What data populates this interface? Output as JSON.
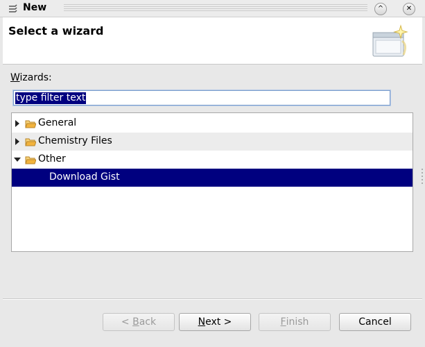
{
  "window": {
    "title": "New"
  },
  "header": {
    "title": "Select a wizard"
  },
  "wizards": {
    "label_first": "W",
    "label_rest": "izards:",
    "filter_value": "type filter text"
  },
  "tree": {
    "items": [
      {
        "label": "General",
        "expanded": false
      },
      {
        "label": "Chemistry Files",
        "expanded": false
      },
      {
        "label": "Other",
        "expanded": true
      },
      {
        "label": "Download Gist",
        "selected": true
      }
    ]
  },
  "buttons": {
    "back": {
      "prefix": "< ",
      "mnemonic": "B",
      "rest": "ack",
      "enabled": false
    },
    "next": {
      "mnemonic": "N",
      "rest": "ext >",
      "enabled": true
    },
    "finish": {
      "mnemonic": "F",
      "rest": "inish",
      "enabled": false
    },
    "cancel": {
      "label": "Cancel",
      "enabled": true
    }
  },
  "colors": {
    "selection": "#00007f",
    "folder": "#f2b33d"
  }
}
